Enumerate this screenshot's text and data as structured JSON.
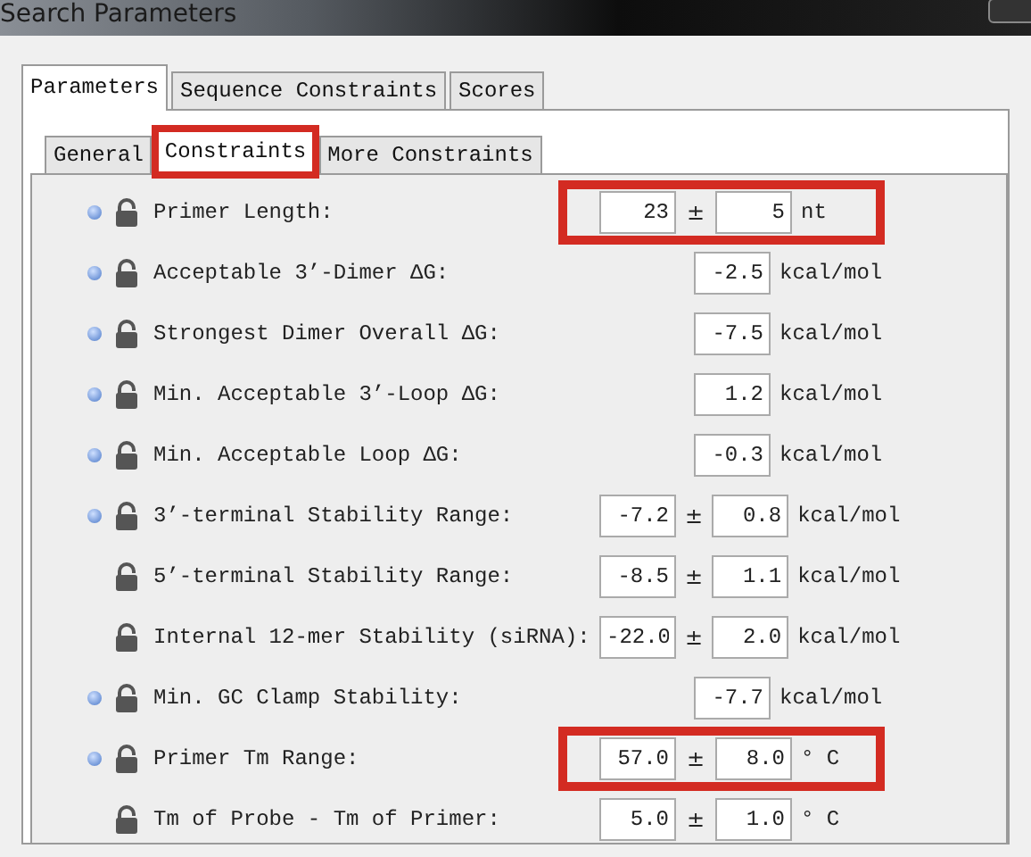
{
  "window": {
    "title": "Search Parameters"
  },
  "outer_tabs": [
    {
      "label": "Parameters",
      "selected": true
    },
    {
      "label": "Sequence Constraints",
      "selected": false
    },
    {
      "label": "Scores",
      "selected": false
    }
  ],
  "inner_tabs": [
    {
      "label": "General",
      "selected": false,
      "highlighted": false
    },
    {
      "label": "Constraints",
      "selected": true,
      "highlighted": true
    },
    {
      "label": "More Constraints",
      "selected": false,
      "highlighted": false
    }
  ],
  "rows": [
    {
      "info": true,
      "label": "Primer Length:",
      "value": "23",
      "separator": "±",
      "tolerance": "5",
      "unit": "nt",
      "highlighted": true
    },
    {
      "info": true,
      "label": "Acceptable 3’-Dimer ΔG:",
      "tolerance": "-2.5",
      "unit": "kcal/mol",
      "highlighted": false
    },
    {
      "info": true,
      "label": "Strongest Dimer Overall ΔG:",
      "tolerance": "-7.5",
      "unit": "kcal/mol",
      "highlighted": false
    },
    {
      "info": true,
      "label": "Min. Acceptable 3’-Loop ΔG:",
      "tolerance": "1.2",
      "unit": "kcal/mol",
      "highlighted": false
    },
    {
      "info": true,
      "label": "Min. Acceptable Loop ΔG:",
      "tolerance": "-0.3",
      "unit": "kcal/mol",
      "highlighted": false
    },
    {
      "info": true,
      "label": "3’-terminal Stability Range:",
      "value": "-7.2",
      "separator": "±",
      "tolerance": "0.8",
      "unit": "kcal/mol",
      "highlighted": false
    },
    {
      "info": false,
      "label": "5’-terminal Stability Range:",
      "value": "-8.5",
      "separator": "±",
      "tolerance": "1.1",
      "unit": "kcal/mol",
      "highlighted": false
    },
    {
      "info": false,
      "label": "Internal 12-mer Stability (siRNA):",
      "value": "-22.0",
      "separator": "±",
      "tolerance": "2.0",
      "unit": "kcal/mol",
      "highlighted": false
    },
    {
      "info": true,
      "label": "Min. GC Clamp Stability:",
      "tolerance": "-7.7",
      "unit": "kcal/mol",
      "highlighted": false
    },
    {
      "info": true,
      "label": "Primer Tm Range:",
      "value": "57.0",
      "separator": "±",
      "tolerance": "8.0",
      "unit": "° C",
      "highlighted": true
    },
    {
      "info": false,
      "label": "Tm of Probe - Tm of Primer:",
      "value": "5.0",
      "separator": "±",
      "tolerance": "1.0",
      "unit": "° C",
      "highlighted": false
    }
  ]
}
